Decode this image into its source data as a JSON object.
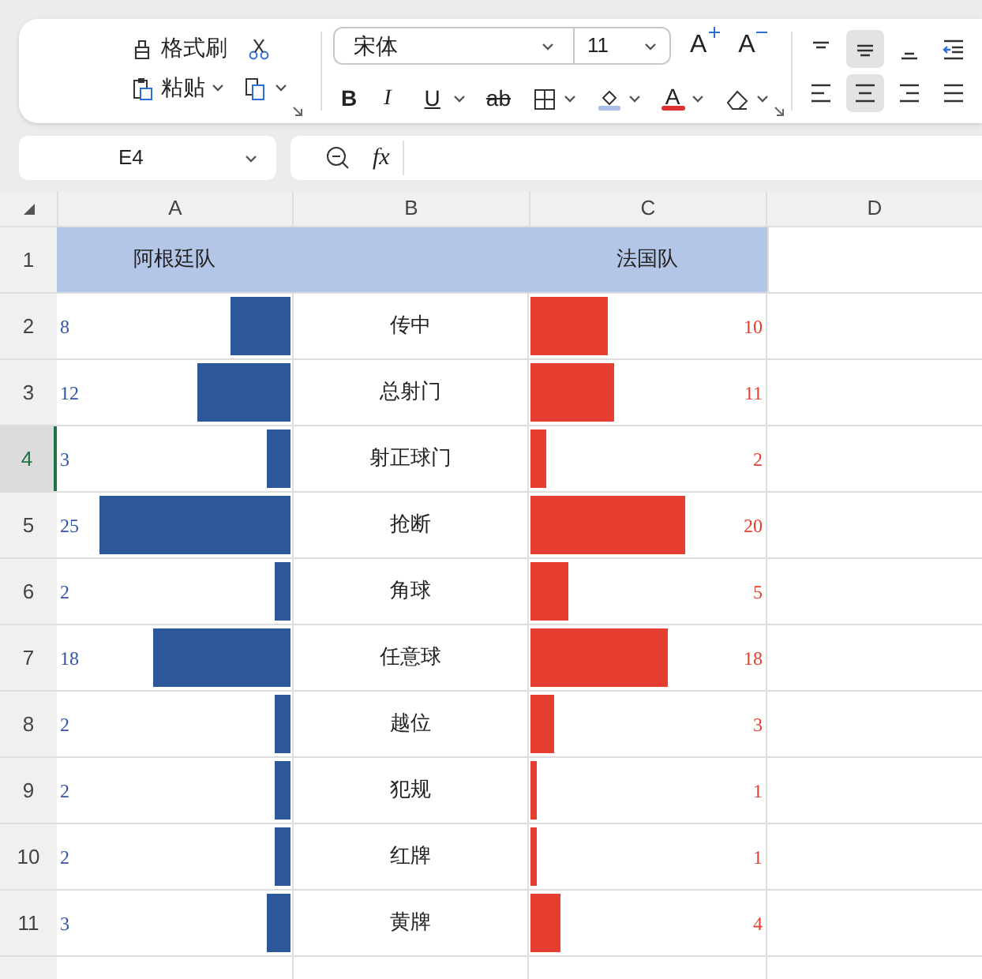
{
  "ribbon": {
    "clipboard": {
      "format_painter": "格式刷",
      "paste": "粘贴"
    },
    "font": {
      "name": "宋体",
      "size": "11",
      "grow": "A",
      "shrink": "A",
      "bold": "B",
      "italic": "I",
      "underline": "U",
      "strike": "ab",
      "font_color": "A"
    },
    "align": [
      {
        "kind": "top",
        "selected": false
      },
      {
        "kind": "middle",
        "selected": true
      },
      {
        "kind": "bottom",
        "selected": false
      },
      {
        "kind": "indent",
        "selected": false
      },
      {
        "kind": "left",
        "selected": false
      },
      {
        "kind": "center",
        "selected": true
      },
      {
        "kind": "right",
        "selected": false
      },
      {
        "kind": "justify",
        "selected": false
      }
    ]
  },
  "formula_bar": {
    "name_box": "E4",
    "fx": "fx"
  },
  "sheet": {
    "columns": [
      "A",
      "B",
      "C",
      "D"
    ],
    "header_row": {
      "label": "1",
      "team_a": "阿根廷队",
      "team_b": "法国队"
    },
    "rows": [
      {
        "label": "2",
        "selected": false,
        "a": {
          "value": "8",
          "level": 0.26
        },
        "stat": "传中",
        "b": {
          "value": "10",
          "level": 0.33
        }
      },
      {
        "label": "3",
        "selected": false,
        "a": {
          "value": "12",
          "level": 0.4
        },
        "stat": "总射门",
        "b": {
          "value": "11",
          "level": 0.36
        }
      },
      {
        "label": "4",
        "selected": true,
        "a": {
          "value": "3",
          "level": 0.1
        },
        "stat": "射正球门",
        "b": {
          "value": "2",
          "level": 0.07
        }
      },
      {
        "label": "5",
        "selected": false,
        "a": {
          "value": "25",
          "level": 0.82
        },
        "stat": "抢断",
        "b": {
          "value": "20",
          "level": 0.66
        }
      },
      {
        "label": "6",
        "selected": false,
        "a": {
          "value": "2",
          "level": 0.07
        },
        "stat": "角球",
        "b": {
          "value": "5",
          "level": 0.16
        }
      },
      {
        "label": "7",
        "selected": false,
        "a": {
          "value": "18",
          "level": 0.59
        },
        "stat": "任意球",
        "b": {
          "value": "18",
          "level": 0.59
        }
      },
      {
        "label": "8",
        "selected": false,
        "a": {
          "value": "2",
          "level": 0.07
        },
        "stat": "越位",
        "b": {
          "value": "3",
          "level": 0.1
        }
      },
      {
        "label": "9",
        "selected": false,
        "a": {
          "value": "2",
          "level": 0.07
        },
        "stat": "犯规",
        "b": {
          "value": "1",
          "level": 0.03
        }
      },
      {
        "label": "10",
        "selected": false,
        "a": {
          "value": "2",
          "level": 0.07
        },
        "stat": "红牌",
        "b": {
          "value": "1",
          "level": 0.03
        }
      },
      {
        "label": "11",
        "selected": false,
        "a": {
          "value": "3",
          "level": 0.1
        },
        "stat": "黄牌",
        "b": {
          "value": "4",
          "level": 0.13
        }
      }
    ]
  }
}
